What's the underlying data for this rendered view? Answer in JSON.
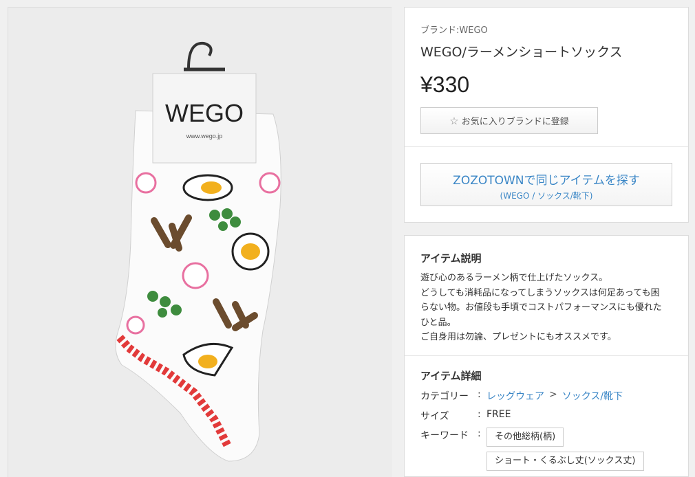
{
  "product": {
    "brand_line": "ブランド:WEGO",
    "title": "WEGO/ラーメンショートソックス",
    "price": "¥330",
    "image_alt": "ラーメン柄ショートソックス"
  },
  "favorite_button": {
    "icon": "star-outline-icon",
    "label": "お気に入りブランドに登録"
  },
  "zozo_button": {
    "main": "ZOZOTOWNで同じアイテムを探す",
    "sub": "(WEGO / ソックス/靴下)"
  },
  "tag_card": {
    "logo": "WEGO",
    "url": "www.wego.jp"
  },
  "description": {
    "title": "アイテム説明",
    "lines": [
      "遊び心のあるラーメン柄で仕上げたソックス。",
      "どうしても消耗品になってしまうソックスは何足あっても困",
      "らない物。お値段も手頃でコストパフォーマンスにも優れた",
      "ひと品。",
      "ご自身用は勿論、プレゼントにもオススメです。"
    ]
  },
  "details": {
    "title": "アイテム詳細",
    "category_label": "カテゴリー",
    "category_path": [
      "レッグウェア",
      "ソックス/靴下"
    ],
    "category_separator": ">",
    "size_label": "サイズ",
    "size_value": "FREE",
    "keyword_label": "キーワード",
    "keywords": [
      "その他総柄(柄)",
      "ショート・くるぶし丈(ソックス丈)"
    ],
    "colon": ":"
  },
  "colors": {
    "link": "#3a86c6",
    "egg_yolk": "#f2b01e",
    "greens": "#3e8c3e",
    "pink": "#e870a0",
    "border_red": "#e23a3a"
  }
}
